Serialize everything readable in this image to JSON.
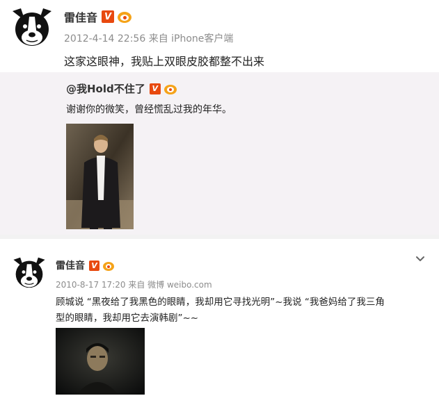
{
  "posts": [
    {
      "author": "雷佳音",
      "verified_badge": "V",
      "timestamp": "2012-4-14 22:56",
      "source": "来自 iPhone客户端",
      "text": "这家这眼神，我贴上双眼皮胶都整不出来",
      "repost": {
        "author": "@我Hold不住了",
        "verified_badge": "V",
        "text": "谢谢你的微笑，曾经慌乱过我的年华。"
      }
    },
    {
      "author": "雷佳音",
      "verified_badge": "V",
      "timestamp": "2010-8-17 17:20",
      "source": "来自 微博 weibo.com",
      "text_line1": "顾城说 “黑夜给了我黑色的眼睛，我却用它寻找光明”~我说 “我爸妈给了我三角",
      "text_line2": "型的眼睛，我却用它去演韩剧”~~"
    }
  ],
  "icons": {
    "avatar": "boston-terrier-avatar-icon",
    "verified": "verified-v-icon",
    "vip": "vip-crown-icon",
    "menu": "chevron-down-icon"
  },
  "colors": {
    "badge": "#e8490f",
    "vip": "#f5a319",
    "meta": "#8c8c8c",
    "repost_bg": "#f5f2f5"
  }
}
